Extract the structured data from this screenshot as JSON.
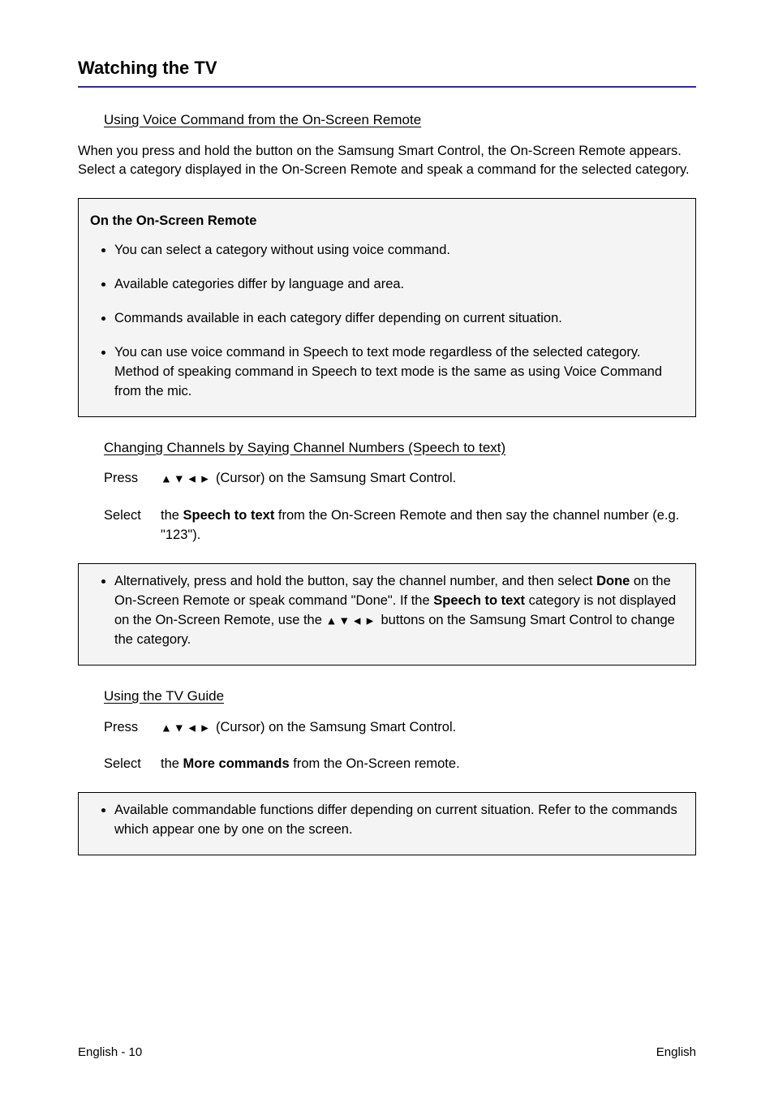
{
  "title": "Watching the TV",
  "sections": [
    {
      "heading": "Using Voice Command from the On-Screen Remote",
      "intro": "When you press and hold the  button on the Samsung Smart Control, the On-Screen Remote appears. Select a category displayed in the On-Screen Remote and speak a command for the selected category.",
      "note_title": "On the On-Screen Remote",
      "notes": [
        "You can select a category without using voice command.",
        "Available categories differ by language and area.",
        "Commands available in each category differ depending on current situation.",
        "You can use voice command in Speech to text mode regardless of the selected category. Method of speaking command in Speech to text mode is the same as using Voice Command from the mic."
      ]
    },
    {
      "heading": "Changing Channels by Saying Channel Numbers (Speech to text)"
    },
    {
      "heading": "Using the TV Guide"
    }
  ],
  "instr1": {
    "label": "Press",
    "cursor_suffix": " (Cursor) on the Samsung Smart Control."
  },
  "instr2": {
    "label": "Select",
    "text_before": " the ",
    "text_mid": " from the On-Screen Remote and then say the channel number (e.g. \"123\")."
  },
  "note2": {
    "text_before": "Alternatively, press and hold the  button, say the channel number, and then select ",
    "text_mid_before": " on the On-Screen Remote or speak command \"Done\". If the ",
    "text_after": " category is not displayed on the On-Screen Remote, use the ",
    "text_tail": " buttons on the Samsung Smart Control to change the category."
  },
  "instr3": {
    "label": "Press",
    "cursor_suffix": " (Cursor) on the Samsung Smart Control."
  },
  "instr4": {
    "label": "Select",
    "text_before": " the ",
    "text_after": " from the On-Screen remote."
  },
  "note3": {
    "text": "Available commandable functions differ depending on current situation. Refer to the commands which appear one by one on the screen."
  },
  "tokens": {
    "done": "Done",
    "speech_to_text": "Speech to text",
    "arrows": "▲▼◄►",
    "more_commands": "More commands"
  },
  "footer": {
    "left": "English - 10",
    "right": "English"
  }
}
